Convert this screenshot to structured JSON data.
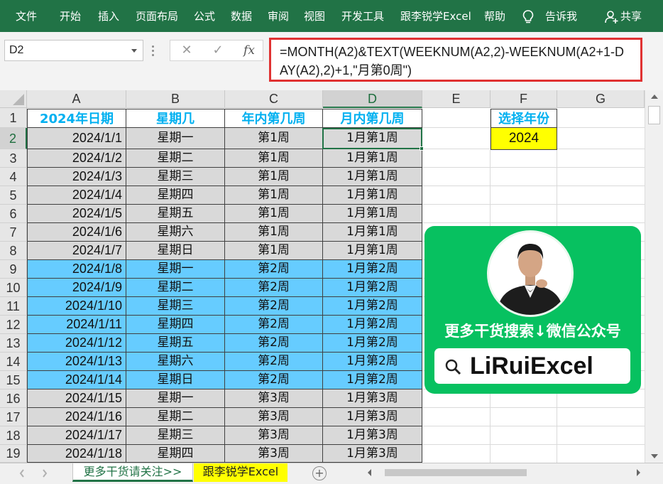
{
  "ribbon": {
    "tabs": [
      "文件",
      "开始",
      "插入",
      "页面布局",
      "公式",
      "数据",
      "审阅",
      "视图",
      "开发工具",
      "跟李锐学Excel",
      "帮助"
    ],
    "tell_me": "告诉我",
    "share": "共享"
  },
  "formula_bar": {
    "name_box": "D2",
    "fx_label": "fx",
    "formula": "=MONTH(A2)&TEXT(WEEKNUM(A2,2)-WEEKNUM(A2+1-DAY(A2),2)+1,\"月第0周\")"
  },
  "columns": [
    "A",
    "B",
    "C",
    "D",
    "E",
    "F",
    "G"
  ],
  "rows": [
    1,
    2,
    3,
    4,
    5,
    6,
    7,
    8,
    9,
    10,
    11,
    12,
    13,
    14,
    15,
    16,
    17,
    18,
    19
  ],
  "table": {
    "headers": [
      "2024年日期",
      "星期几",
      "年内第几周",
      "月内第几周"
    ],
    "data": [
      [
        "2024/1/1",
        "星期一",
        "第1周",
        "1月第1周"
      ],
      [
        "2024/1/2",
        "星期二",
        "第1周",
        "1月第1周"
      ],
      [
        "2024/1/3",
        "星期三",
        "第1周",
        "1月第1周"
      ],
      [
        "2024/1/4",
        "星期四",
        "第1周",
        "1月第1周"
      ],
      [
        "2024/1/5",
        "星期五",
        "第1周",
        "1月第1周"
      ],
      [
        "2024/1/6",
        "星期六",
        "第1周",
        "1月第1周"
      ],
      [
        "2024/1/7",
        "星期日",
        "第1周",
        "1月第1周"
      ],
      [
        "2024/1/8",
        "星期一",
        "第2周",
        "1月第2周"
      ],
      [
        "2024/1/9",
        "星期二",
        "第2周",
        "1月第2周"
      ],
      [
        "2024/1/10",
        "星期三",
        "第2周",
        "1月第2周"
      ],
      [
        "2024/1/11",
        "星期四",
        "第2周",
        "1月第2周"
      ],
      [
        "2024/1/12",
        "星期五",
        "第2周",
        "1月第2周"
      ],
      [
        "2024/1/13",
        "星期六",
        "第2周",
        "1月第2周"
      ],
      [
        "2024/1/14",
        "星期日",
        "第2周",
        "1月第2周"
      ],
      [
        "2024/1/15",
        "星期一",
        "第3周",
        "1月第3周"
      ],
      [
        "2024/1/16",
        "星期二",
        "第3周",
        "1月第3周"
      ],
      [
        "2024/1/17",
        "星期三",
        "第3周",
        "1月第3周"
      ],
      [
        "2024/1/18",
        "星期四",
        "第3周",
        "1月第3周"
      ]
    ],
    "row_fill": [
      "gray",
      "gray",
      "gray",
      "gray",
      "gray",
      "gray",
      "gray",
      "blue",
      "blue",
      "blue",
      "blue",
      "blue",
      "blue",
      "blue",
      "gray",
      "gray",
      "gray",
      "gray"
    ]
  },
  "year_selector": {
    "label": "选择年份",
    "value": "2024",
    "value_color": "#ffff00",
    "label_color": "#00b0f0"
  },
  "promo": {
    "text": "更多干货搜索↓微信公众号",
    "brand": "LiRuiExcel",
    "background": "#07c160",
    "avatar": "person-in-suit-avatar"
  },
  "sheet_tabs": [
    "更多干货请关注>>",
    "跟李锐学Excel"
  ],
  "colors": {
    "ribbon": "#217346",
    "header_text": "#00b0f0",
    "gray_fill": "#d9d9d9",
    "blue_fill": "#66ccff",
    "formula_highlight": "#e03232"
  }
}
